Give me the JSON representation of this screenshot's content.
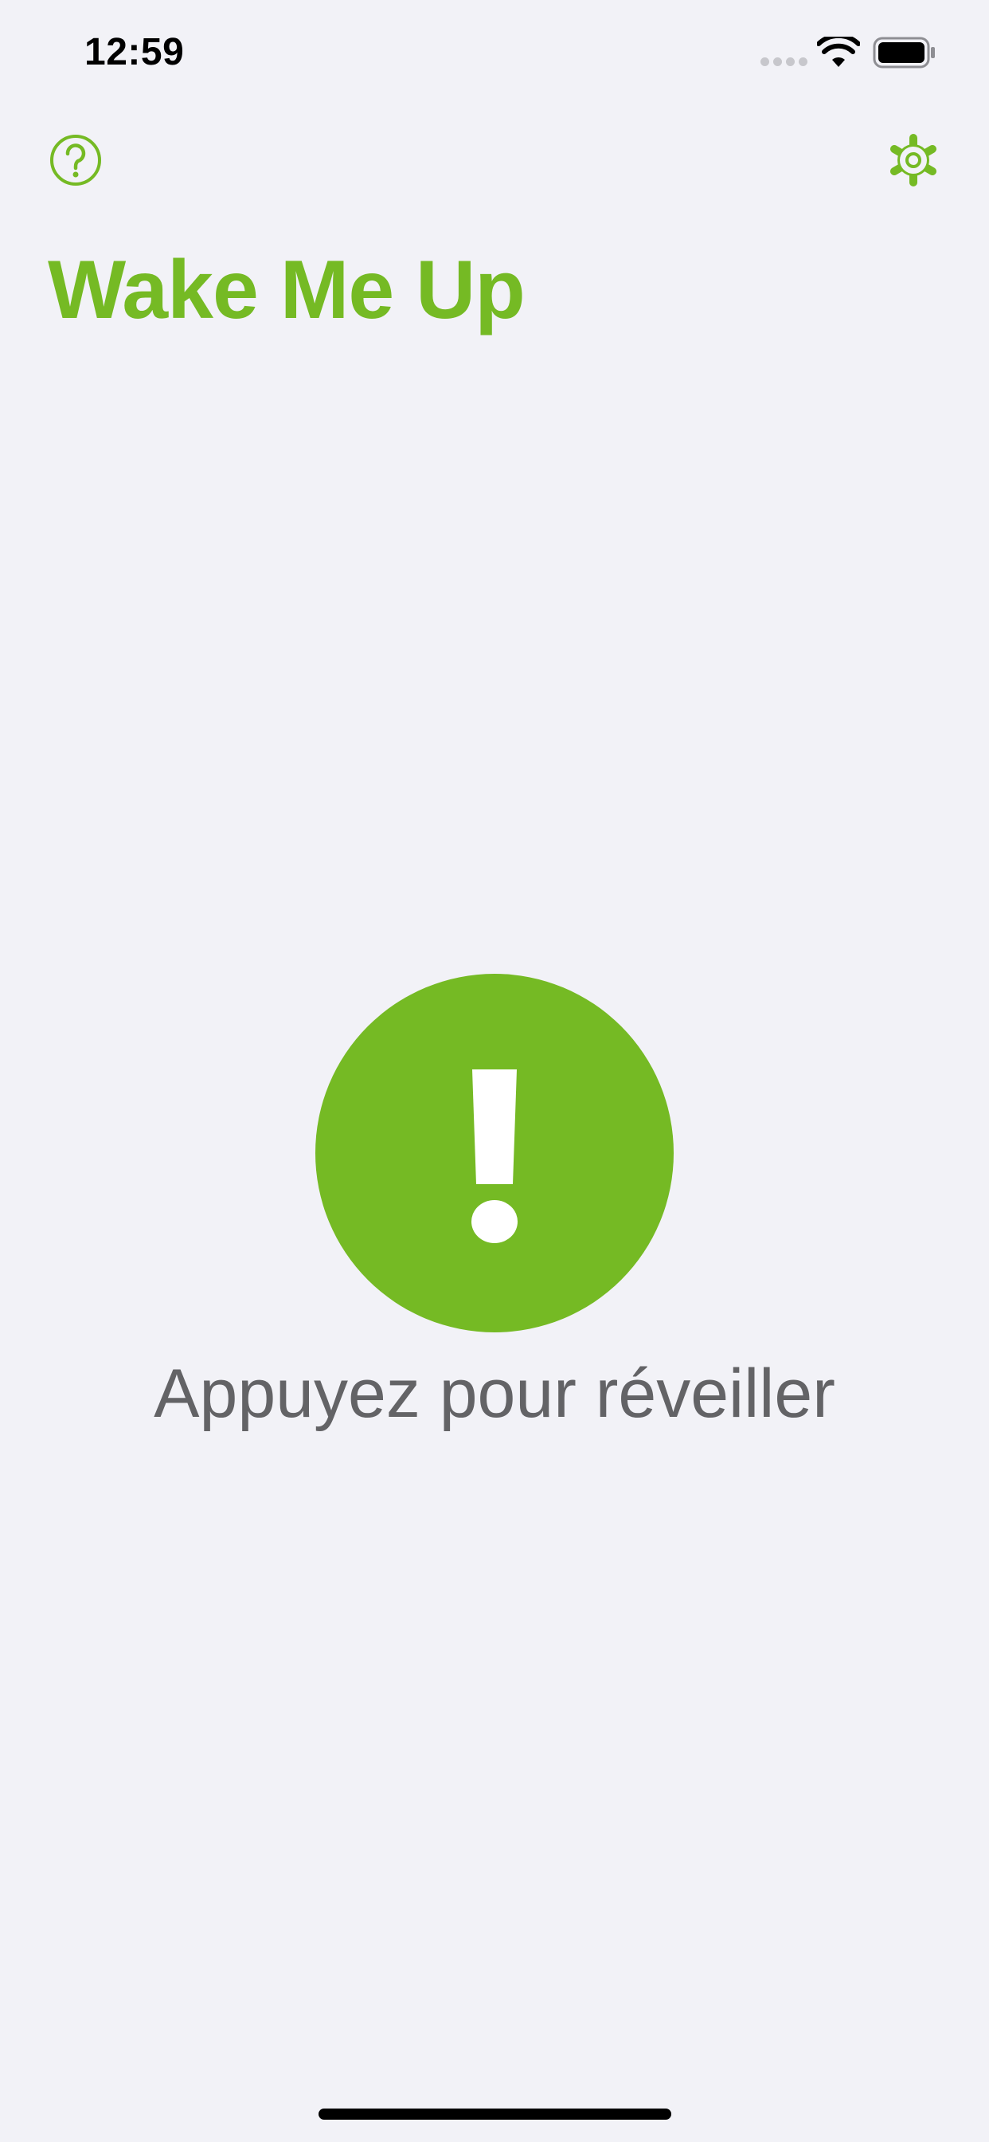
{
  "status_bar": {
    "time": "12:59",
    "signal_icon": "cellular-signal-icon",
    "wifi_icon": "wifi-icon",
    "battery_icon": "battery-icon"
  },
  "nav": {
    "help_icon": "help-circle-icon",
    "settings_icon": "gear-icon"
  },
  "title": "Wake Me Up",
  "wake": {
    "icon": "exclamation-icon",
    "label": "Appuyez pour réveiller"
  },
  "colors": {
    "accent": "#75ba24",
    "background": "#f2f2f7",
    "secondary_text": "#636366"
  }
}
